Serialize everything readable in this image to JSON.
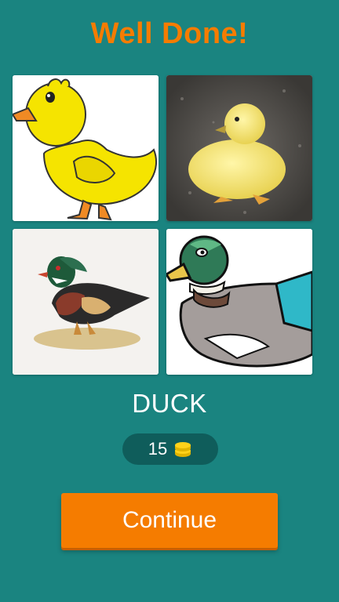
{
  "header": {
    "title": "Well Done!"
  },
  "puzzle": {
    "images": [
      {
        "icon": "cartoon-duckling-icon"
      },
      {
        "icon": "duckling-photo-icon"
      },
      {
        "icon": "wood-duck-illustration-icon"
      },
      {
        "icon": "mallard-clipart-icon"
      }
    ],
    "answer": "DUCK"
  },
  "reward": {
    "coins": "15",
    "icon": "coin-stack-icon"
  },
  "actions": {
    "continue_label": "Continue"
  },
  "colors": {
    "background": "#1a8480",
    "accent": "#f57c00",
    "coin_pill": "#0f5d5b"
  }
}
